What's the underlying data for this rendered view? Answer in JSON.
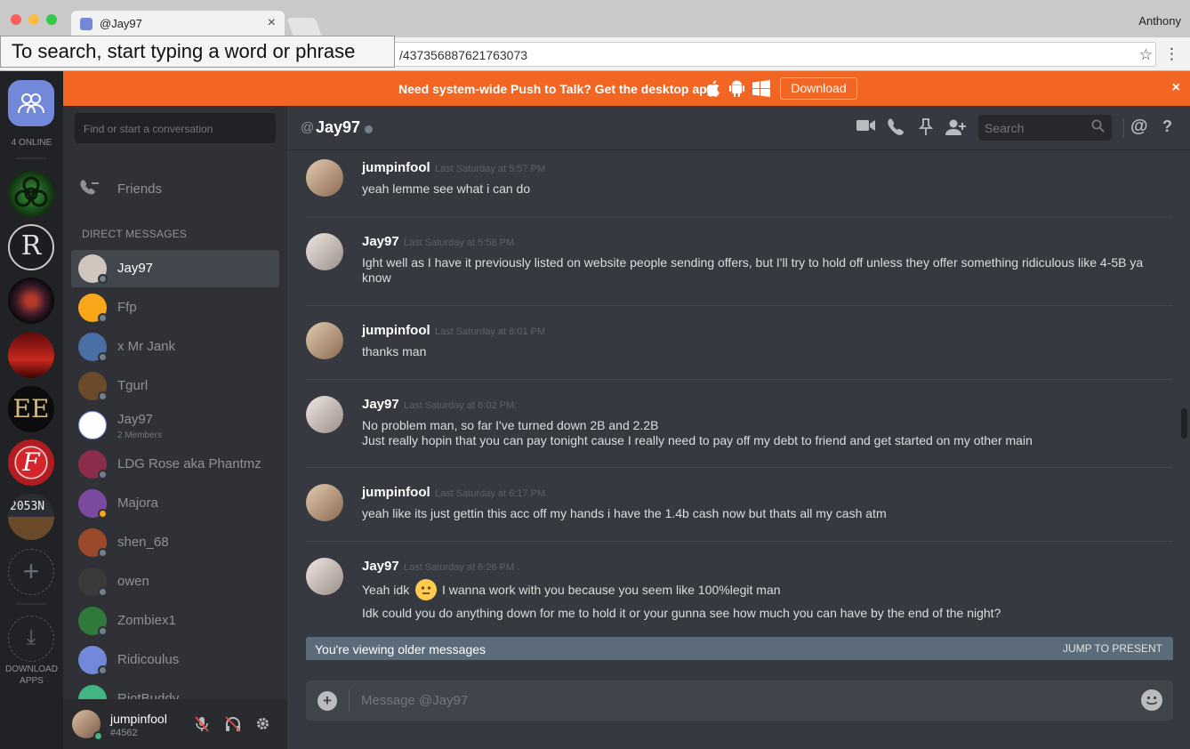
{
  "browser": {
    "tab_title": "@Jay97",
    "tab_close": "×",
    "profile_name": "Anthony",
    "url": "/437356887621763073",
    "search_tip": "To search, start typing a word or phrase",
    "star": "☆",
    "menu": "⋮"
  },
  "banner": {
    "message": "Need system-wide Push to Talk? Get the desktop app!",
    "download_label": "Download",
    "close": "×",
    "bg_color": "#f26522"
  },
  "guild_rail": {
    "online_label": "4 ONLINE",
    "download_apps_label_1": "DOWNLOAD",
    "download_apps_label_2": "APPS",
    "add_glyph": "+",
    "download_glyph": "⤓",
    "guild_5_text": "EE",
    "guild_7_text": "2053N"
  },
  "dm_sidebar": {
    "search_placeholder": "Find or start a conversation",
    "friends_label": "Friends",
    "dm_header": "DIRECT MESSAGES",
    "items": [
      {
        "name": "Jay97",
        "sub": "",
        "active": true,
        "color": "#d0c6be",
        "status": "#747f8d"
      },
      {
        "name": "Ffp",
        "sub": "",
        "active": false,
        "color": "#faa61a",
        "status": "#747f8d"
      },
      {
        "name": "x Mr Jank",
        "sub": "",
        "active": false,
        "color": "#4a6fa5",
        "status": "#747f8d"
      },
      {
        "name": "Tgurl",
        "sub": "",
        "active": false,
        "color": "#6b4a2a",
        "status": "#747f8d"
      },
      {
        "name": "Jay97",
        "sub": "2 Members",
        "active": false,
        "color": "#ffffff",
        "status": ""
      },
      {
        "name": "LDG Rose aka Phantmz",
        "sub": "",
        "active": false,
        "color": "#8b2d4a",
        "status": "#747f8d"
      },
      {
        "name": "Majora",
        "sub": "",
        "active": false,
        "color": "#7a4aa0",
        "status": "#faa61a"
      },
      {
        "name": "shen_68",
        "sub": "",
        "active": false,
        "color": "#9a4a2a",
        "status": "#747f8d"
      },
      {
        "name": "owen",
        "sub": "",
        "active": false,
        "color": "#3a3a3a",
        "status": "#747f8d"
      },
      {
        "name": "Zombiex1",
        "sub": "",
        "active": false,
        "color": "#2f7a3a",
        "status": "#747f8d"
      },
      {
        "name": "Ridicoulus",
        "sub": "",
        "active": false,
        "color": "#7289da",
        "status": "#747f8d"
      },
      {
        "name": "RiotBuddy",
        "sub": "",
        "active": false,
        "color": "#43b581",
        "status": "#747f8d"
      }
    ]
  },
  "user_panel": {
    "username": "jumpinfool",
    "tag": "#4562"
  },
  "chat": {
    "at_symbol": "@",
    "channel_name": "Jay97",
    "search_placeholder": "Search",
    "mention_glyph": "@",
    "help_glyph": "?",
    "messages": [
      {
        "author": "jumpinfool",
        "time": "Last Saturday at 5:57 PM",
        "lines": [
          "yeah lemme see what i can do"
        ]
      },
      {
        "author": "Jay97",
        "time": "Last Saturday at 5:58 PM",
        "lines": [
          "Ight well as I have it previously listed on website people sending offers, but I'll try to hold off unless they offer something ridiculous like 4-5B ya know"
        ]
      },
      {
        "author": "jumpinfool",
        "time": "Last Saturday at 6:01 PM",
        "lines": [
          "thanks man"
        ]
      },
      {
        "author": "Jay97",
        "time": "Last Saturday at 6:02 PM",
        "lines": [
          "No problem man, so far I've turned down 2B and 2.2B",
          "Just really hopin that you can pay tonight cause I really need to pay off my debt to friend and get started on my other main"
        ]
      },
      {
        "author": "jumpinfool",
        "time": "Last Saturday at 6:17 PM",
        "lines": [
          "yeah like its just gettin this acc off my hands i have the 1.4b cash now but thats all my cash atm"
        ]
      },
      {
        "author": "Jay97",
        "time": "Last Saturday at 6:26 PM",
        "lines": [
          "Yeah idk",
          "I wanna work with you because you seem like 100%legit man",
          "Idk could you do anything down for me to hold it or your gunna see how much you can have by the end of the night?"
        ]
      }
    ],
    "older_notice": "You're viewing older messages",
    "jump_label": "JUMP TO PRESENT",
    "composer_placeholder": "Message @Jay97",
    "composer_plus": "+"
  }
}
